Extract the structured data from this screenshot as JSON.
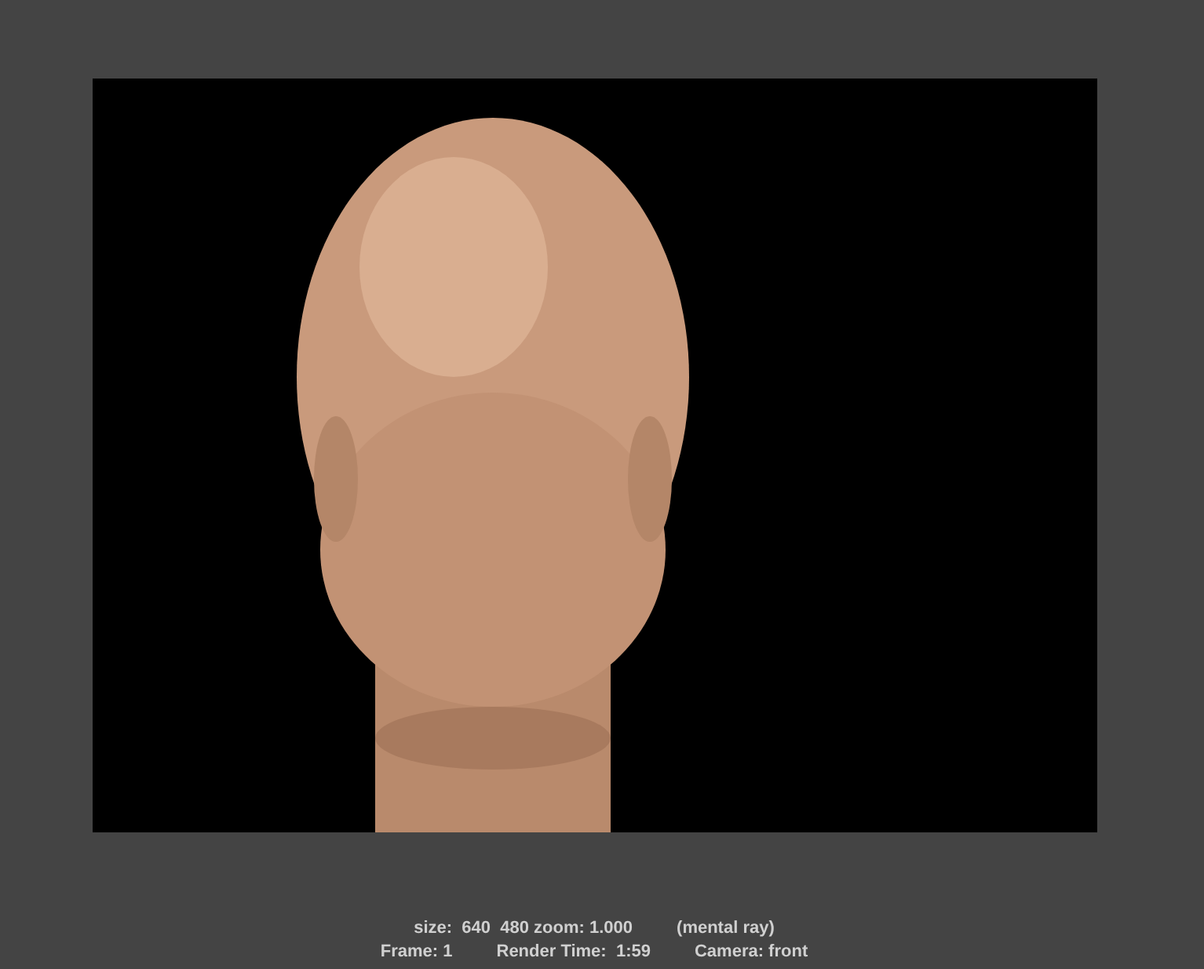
{
  "render_view": {
    "image": {
      "kind": "picture"
    },
    "info_lines": [
      [
        "size:  640  480 zoom: 1.000",
        "(mental ray)"
      ],
      [
        "Frame: 1",
        "Render Time:  1:59",
        "Camera: front"
      ]
    ]
  }
}
